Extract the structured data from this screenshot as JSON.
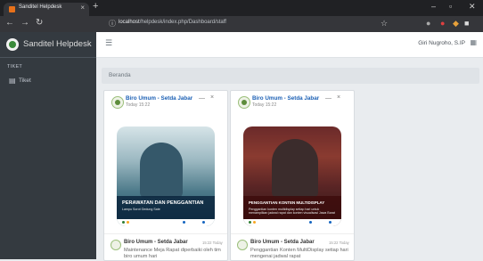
{
  "browser": {
    "tab_title": "Sanditel Helpdesk",
    "tab_close": "×",
    "new_tab": "+",
    "minimize": "–",
    "maximize": "▫",
    "close": "✕",
    "back": "←",
    "forward": "→",
    "reload": "↻",
    "security": "ⓘ",
    "url_host": "localhost",
    "url_path": "/helpdesk/index.php/Dashboard/staff",
    "star": "☆"
  },
  "app": {
    "brand": "Sanditel Helpdesk",
    "sidebar": {
      "section": "TIKET",
      "items": [
        {
          "label": "Tiket",
          "icon": "ticket-icon"
        }
      ]
    },
    "navbar": {
      "menu_icon": "☰",
      "user": "Giri Nugroho, S.IP",
      "apps_icon": "▦"
    },
    "breadcrumb": "Beranda"
  },
  "colors": {
    "sidebar": "#343a40",
    "link": "#1a5fb4",
    "content_bg": "#e9ecef"
  },
  "posts": [
    {
      "author": "Biro Umum - Setda Jabar",
      "time": "Today 15:22",
      "image_title": "PERAWATAN DAN PENGGANTIAN",
      "image_subtitle": "Lampu Sorot Gedung Sate",
      "feed_author": "Biro Umum - Setda Jabar",
      "feed_time": "15:22 Today",
      "feed_text": "Maintenance Meja Rapat diperbaiki oleh tim biro umum hari"
    },
    {
      "author": "Biro Umum - Setda Jabar",
      "time": "Today 15:22",
      "image_title": "PENGGANTIAN KONTEN MULTIDISPLAY",
      "image_subtitle": "Penggantian konten multidisplay setiap hari untuk menampilkan jadwal rapat dan konten visualisasi Jawa Barat",
      "feed_author": "Biro Umum - Setda Jabar",
      "feed_time": "15:22 Today",
      "feed_text": "Penggantian Konten MultiDisplay setiap hari mengenai jadwal rapat"
    }
  ]
}
